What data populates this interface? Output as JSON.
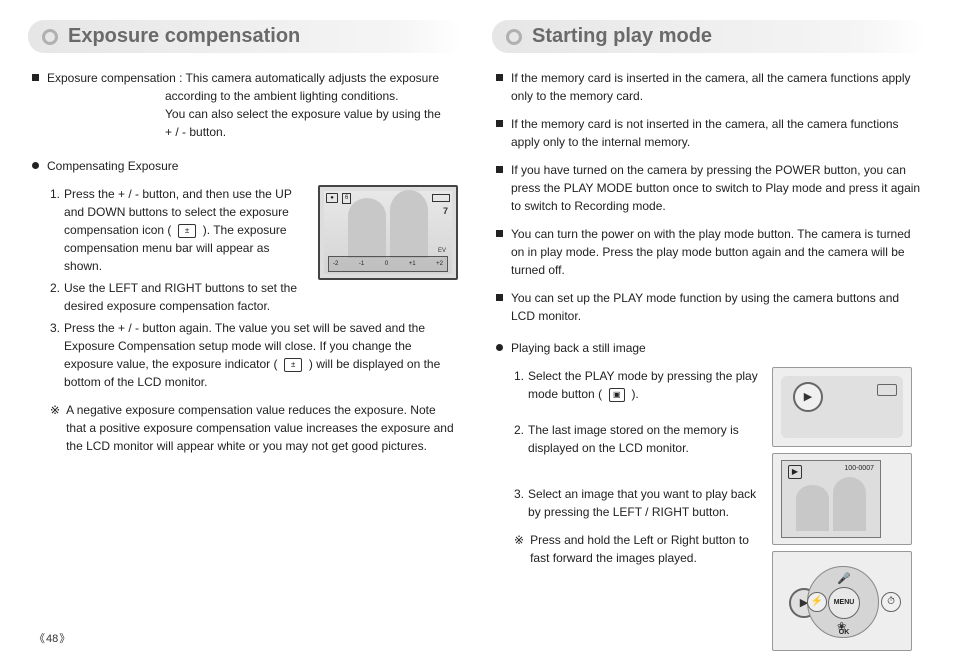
{
  "page_number": "48",
  "left": {
    "title": "Exposure compensation",
    "intro_label": "Exposure compensation :",
    "intro_lines": [
      "This camera automatically adjusts the exposure",
      "according to the ambient lighting conditions.",
      "You can also select the exposure value by using the",
      "+ / - button."
    ],
    "sub_heading": "Compensating Exposure",
    "steps": [
      {
        "n": "1.",
        "text": "Press the + / - button, and then use the UP and DOWN buttons to select the exposure compensation icon (",
        "tail": "). The exposure compensation menu bar will appear as shown."
      },
      {
        "n": "2.",
        "text": "Use the LEFT and RIGHT buttons to set the desired exposure compensation factor.",
        "tail": ""
      },
      {
        "n": "3.",
        "text": "Press the + / - button again. The value you set will be saved and the Exposure Compensation setup mode will close. If you change the exposure value, the exposure indicator (",
        "tail": ") will be displayed on the bottom of the LCD monitor."
      }
    ],
    "note_mark": "※",
    "note_text": "A negative exposure compensation value reduces the exposure. Note that a positive exposure compensation value increases the exposure and the LCD monitor will appear white or you may not get good pictures.",
    "icon_label": "±",
    "lcd_top": "6",
    "lcd_right": "7",
    "lcd_ev": "EV"
  },
  "right": {
    "title": "Starting play mode",
    "bullets": [
      "If the memory card is inserted in the camera, all the camera functions apply only to the memory card.",
      "If the memory card is not inserted in the camera, all the camera functions apply only to the internal memory.",
      "If you have turned on the camera by pressing the POWER button, you can press the PLAY MODE button once to switch to Play mode and press it again to switch to Recording mode.",
      "You can turn the power on with the play mode button. The camera is turned on in play mode. Press the play mode button again and the camera will be turned off.",
      "You can set up the PLAY mode function by using the camera buttons and LCD monitor."
    ],
    "sub_heading": "Playing back a still image",
    "steps": [
      {
        "n": "1.",
        "text": "Select the PLAY mode by pressing the play mode button (",
        "tail": ")."
      },
      {
        "n": "2.",
        "text": "The last image stored on the memory is displayed on the LCD monitor.",
        "tail": ""
      },
      {
        "n": "3.",
        "text": "Select an image that you want to play back by pressing the LEFT / RIGHT button.",
        "tail": ""
      }
    ],
    "note_mark": "※",
    "note_text": "Press and hold the Left or Right button to fast forward the images played.",
    "play_icon": "▣",
    "play_glyph": "▶",
    "lcd_label": "100-0007",
    "dpad_center": "MENU OK",
    "mic_icon": "🎤",
    "flash_icon": "⚡",
    "clock_icon": "⏱",
    "flower_icon": "❀"
  }
}
